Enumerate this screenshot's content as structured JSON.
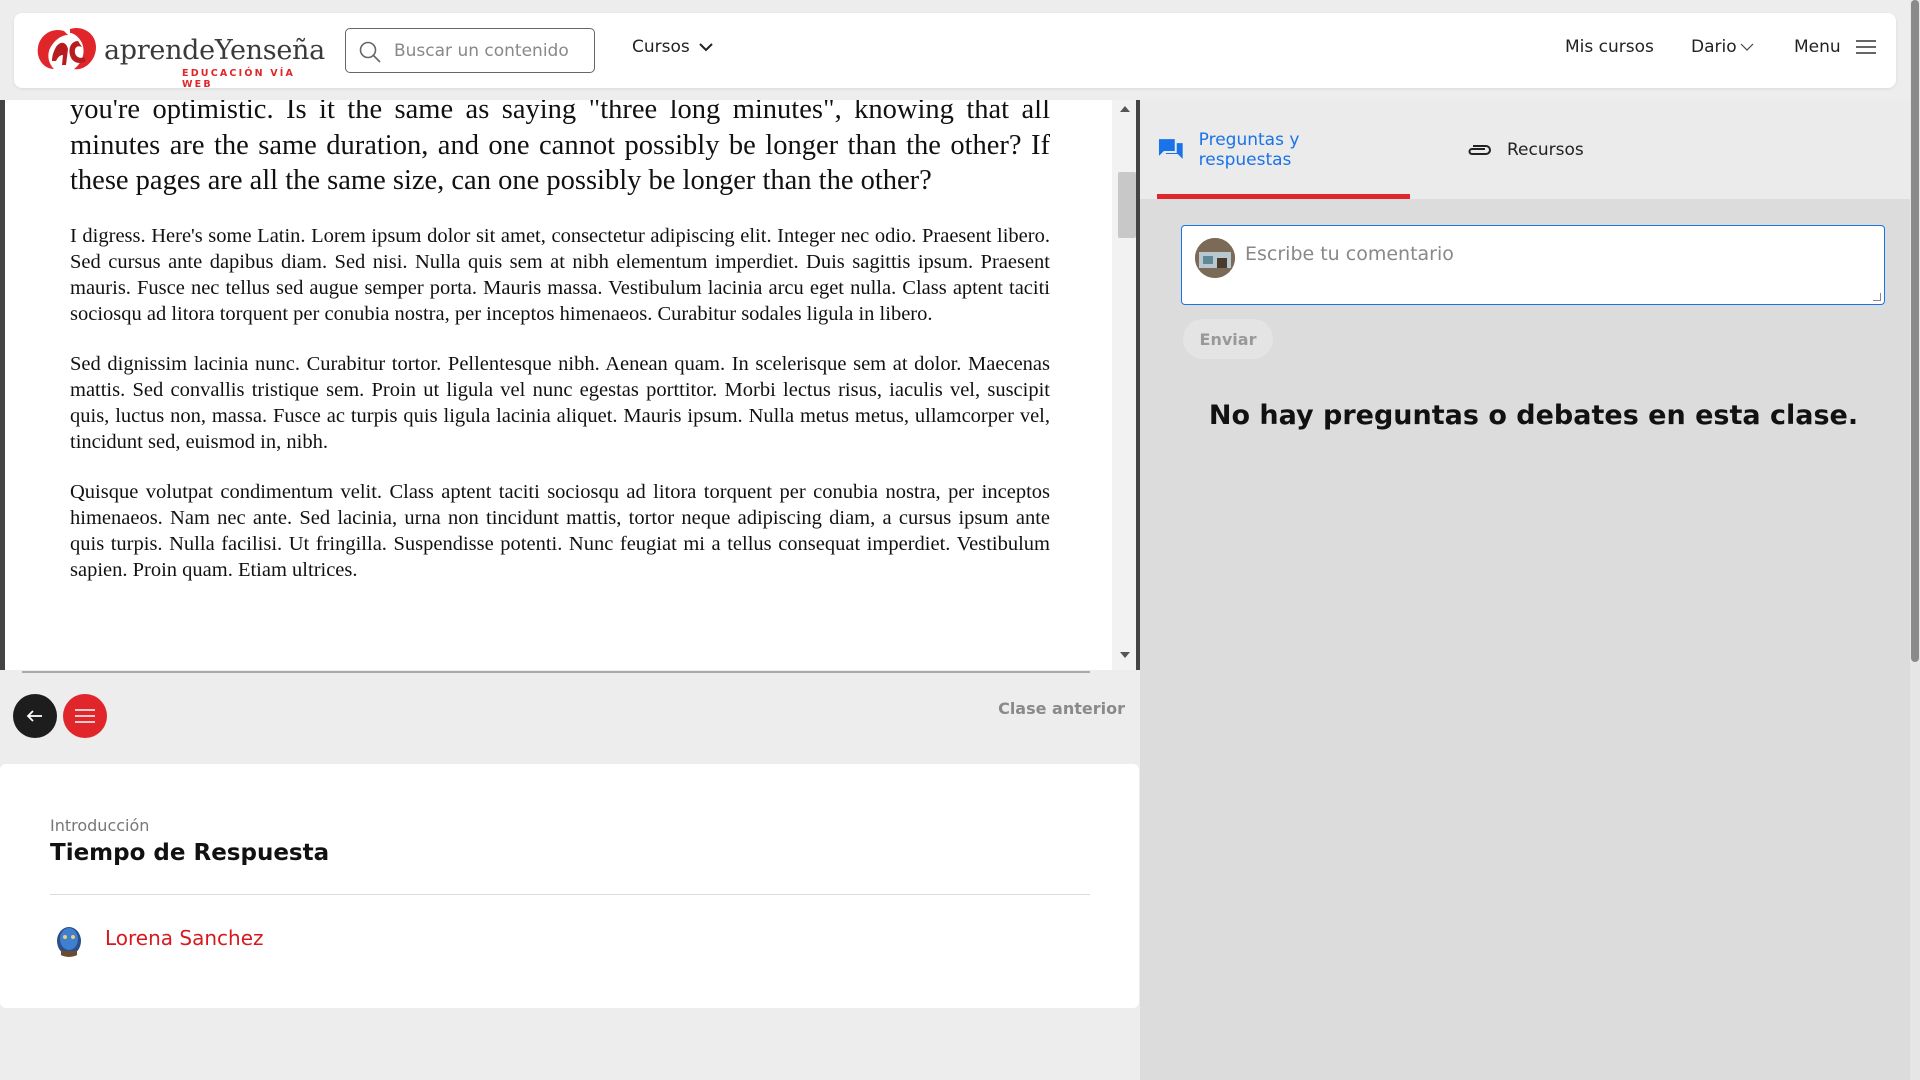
{
  "header": {
    "logo_name": "aprendeYenseña",
    "logo_tagline": "EDUCACIÓN VÍA WEB",
    "search_placeholder": "Buscar un contenido",
    "cursos_label": "Cursos",
    "mis_cursos_label": "Mis cursos",
    "user_label": "Dario",
    "menu_label": "Menu"
  },
  "reader": {
    "intro_paragraph": "you're optimistic. Is it the same as saying \"three long minutes\", knowing that all minutes are the same duration, and one cannot possibly be longer than the other? If these pages are all the same size, can one possibly be longer than the other?",
    "paragraphs": [
      "I digress. Here's some Latin. Lorem ipsum dolor sit amet, consectetur adipiscing elit. Integer nec odio. Praesent libero. Sed cursus ante dapibus diam. Sed nisi. Nulla quis sem at nibh elementum imperdiet. Duis sagittis ipsum. Praesent mauris. Fusce nec tellus sed augue semper porta. Mauris massa. Vestibulum lacinia arcu eget nulla. Class aptent taciti sociosqu ad litora torquent per conubia nostra, per inceptos himenaeos. Curabitur sodales ligula in libero.",
      "Sed dignissim lacinia nunc. Curabitur tortor. Pellentesque nibh. Aenean quam. In scelerisque sem at dolor. Maecenas mattis. Sed convallis tristique sem. Proin ut ligula vel nunc egestas porttitor. Morbi lectus risus, iaculis vel, suscipit quis, luctus non, massa. Fusce ac turpis quis ligula lacinia aliquet. Mauris ipsum. Nulla metus metus, ullamcorper vel, tincidunt sed, euismod in, nibh.",
      "Quisque volutpat condimentum velit. Class aptent taciti sociosqu ad litora torquent per conubia nostra, per inceptos himenaeos. Nam nec ante. Sed lacinia, urna non tincidunt mattis, tortor neque adipiscing diam, a cursus ipsum ante quis turpis. Nulla facilisi. Ut fringilla. Suspendisse potenti. Nunc feugiat mi a tellus consequat imperdiet. Vestibulum sapien. Proin quam. Etiam ultrices."
    ]
  },
  "controls": {
    "prev_class_label": "Clase anterior"
  },
  "lesson": {
    "category": "Introducción",
    "title": "Tiempo de Respuesta",
    "author": "Lorena Sanchez"
  },
  "sidebar": {
    "tabs": [
      {
        "label": "Preguntas y respuestas",
        "icon": "chat-bubbles-icon",
        "active": true
      },
      {
        "label": "Recursos",
        "icon": "paperclip-icon",
        "active": false
      }
    ],
    "comment_placeholder": "Escribe tu comentario",
    "send_label": "Enviar",
    "empty_message": "No hay preguntas o debates en esta clase."
  },
  "colors": {
    "brand_red": "#e1262b",
    "link_blue": "#1a73e8",
    "author_red": "#d7191f"
  }
}
